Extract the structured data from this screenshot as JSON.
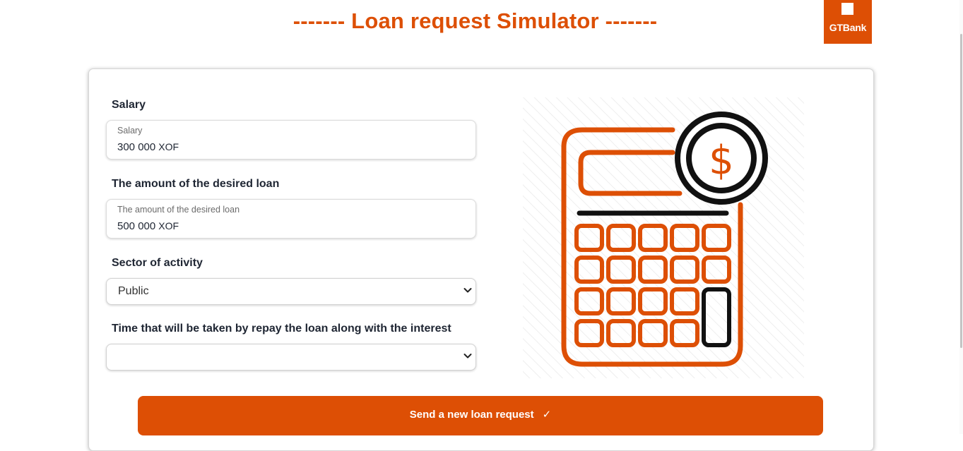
{
  "header": {
    "title": "------- Loan request Simulator -------",
    "logo_text": "GTBank",
    "brand_color": "#dd4f05"
  },
  "form": {
    "salary": {
      "label": "Salary",
      "placeholder": "Salary",
      "value": "300 000",
      "unit": "XOF"
    },
    "loan_amount": {
      "label": "The amount of the desired loan",
      "placeholder": "The amount of the desired loan",
      "value": "500 000",
      "unit": "XOF"
    },
    "sector": {
      "label": "Sector of activity",
      "selected": "Public"
    },
    "repay_time": {
      "label": "Time that will be taken by repay the loan along with the interest",
      "selected": ""
    },
    "submit_label": "Send a new loan request",
    "submit_icon": "check-icon"
  },
  "illustration": {
    "icon": "calculator-dollar-icon"
  }
}
